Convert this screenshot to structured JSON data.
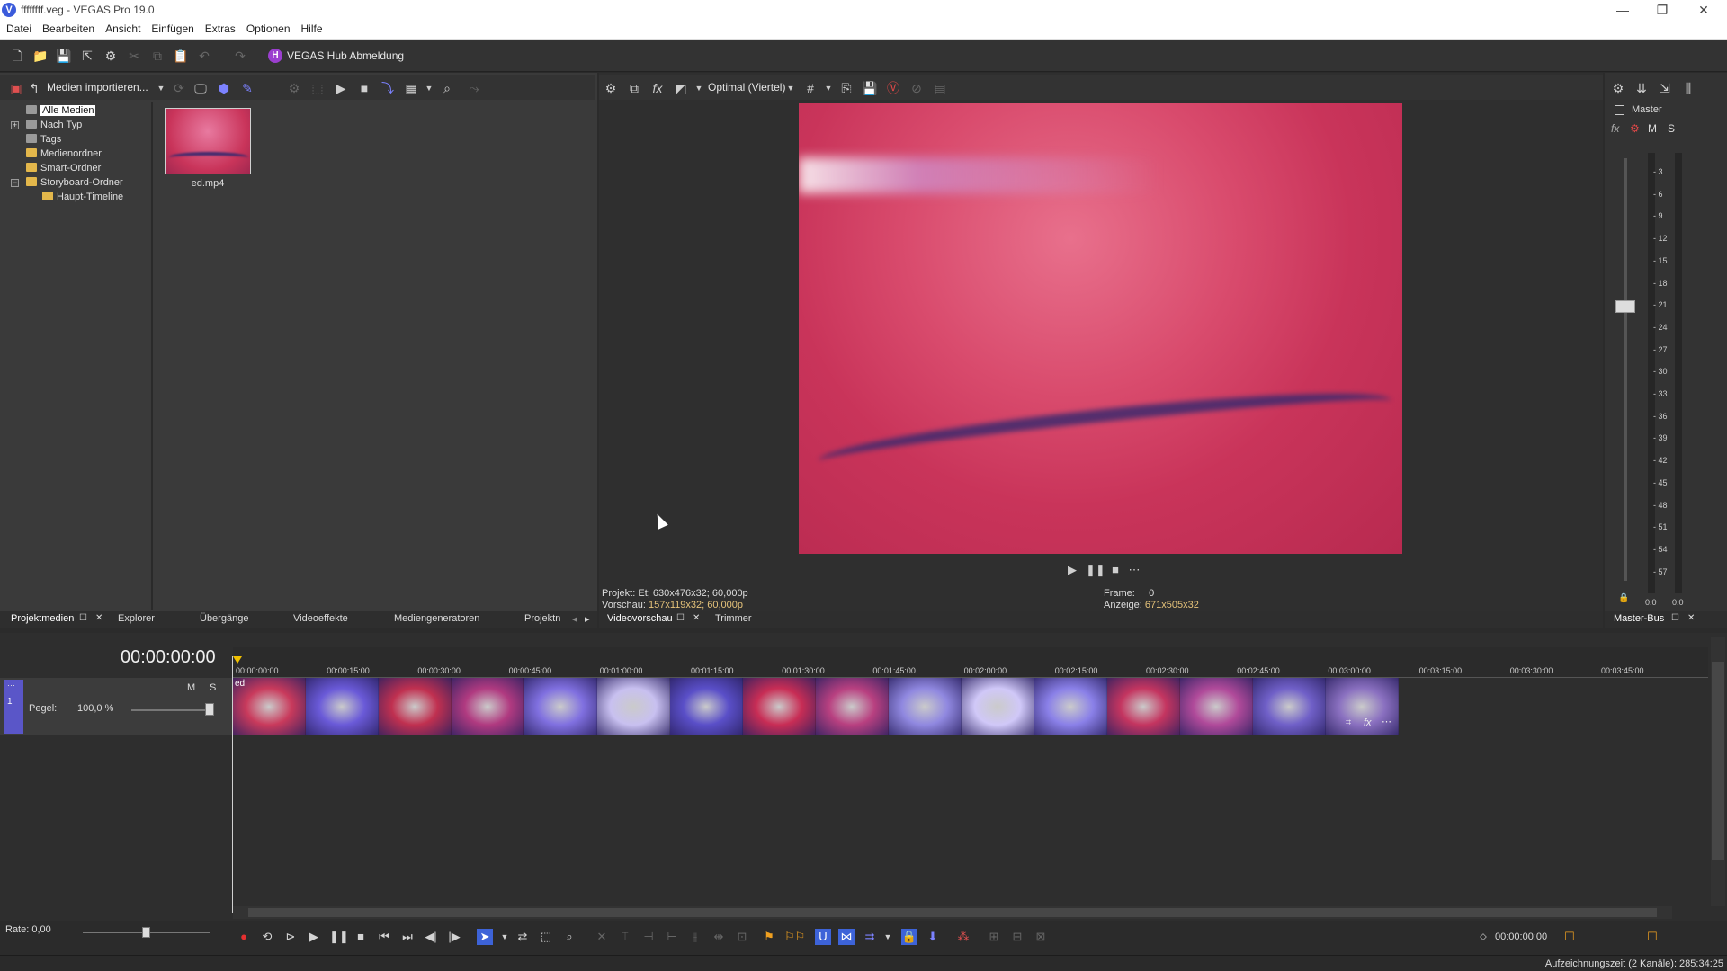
{
  "window": {
    "title": "ffffffff.veg - VEGAS Pro 19.0",
    "logo_letter": "V",
    "controls": [
      "—",
      "❐",
      "✕"
    ]
  },
  "menu": [
    "Datei",
    "Bearbeiten",
    "Ansicht",
    "Einfügen",
    "Extras",
    "Optionen",
    "Hilfe"
  ],
  "toolbar": {
    "hub_logo": "H",
    "hub_label": "VEGAS Hub Abmeldung"
  },
  "media": {
    "import_label": "Medien importieren...",
    "tree": [
      {
        "label": "Alle Medien",
        "icon": "folder-grey-icon",
        "selected": true
      },
      {
        "label": "Nach Typ",
        "icon": "folder-grey-icon",
        "expander": "+"
      },
      {
        "label": "Tags",
        "icon": "folder-grey-icon"
      },
      {
        "label": "Medienordner",
        "icon": "folder-icon"
      },
      {
        "label": "Smart-Ordner",
        "icon": "folder-icon"
      },
      {
        "label": "Storyboard-Ordner",
        "icon": "folder-icon",
        "expander": "−"
      },
      {
        "label": "Haupt-Timeline",
        "icon": "folder-icon"
      }
    ],
    "file_name": "ed.mp4"
  },
  "bottom_tabs_left": {
    "projektmedien": "Projektmedien",
    "explorer": "Explorer",
    "uebergaenge": "Übergänge",
    "videoeffekte": "Videoeffekte",
    "mediengeneratoren": "Mediengeneratoren",
    "projektn": "Projektn"
  },
  "preview": {
    "quality": "Optimal (Viertel)",
    "projekt_label": "Projekt:",
    "projekt_value": "630x476x32; 60,000p",
    "vorschau_label": "Vorschau:",
    "vorschau_value": "157x119x32; 60,000p",
    "frame_label": "Frame:",
    "frame_value": "0",
    "anzeige_label": "Anzeige:",
    "anzeige_value": "671x505x32",
    "tab_videovorschau": "Videovorschau",
    "tab_trimmer": "Trimmer"
  },
  "master": {
    "label": "Master",
    "fx": "fx",
    "m": "M",
    "s": "S",
    "scale": [
      "3",
      "6",
      "9",
      "12",
      "15",
      "18",
      "21",
      "24",
      "27",
      "30",
      "33",
      "36",
      "39",
      "42",
      "45",
      "48",
      "51",
      "54",
      "57"
    ],
    "left_value": "0.0",
    "right_value": "0.0",
    "tab_label": "Master-Bus"
  },
  "timeline": {
    "timecode": "00:00:00:00",
    "ruler": [
      "00:00:00:00",
      "00:00:15:00",
      "00:00:30:00",
      "00:00:45:00",
      "00:01:00:00",
      "00:01:15:00",
      "00:01:30:00",
      "00:01:45:00",
      "00:02:00:00",
      "00:02:15:00",
      "00:02:30:00",
      "00:02:45:00",
      "00:03:00:00",
      "00:03:15:00",
      "00:03:30:00",
      "00:03:45:00"
    ],
    "track_number": "1",
    "track_m": "M",
    "track_s": "S",
    "pegel_label": "Pegel:",
    "pegel_value": "100,0 %",
    "clip_label": "ed",
    "thumb_colors": [
      "#c93a5c",
      "#6a5ad8",
      "#c03050",
      "#b03a80",
      "#8070e0",
      "#c8c0f0",
      "#5a4fc8",
      "#c82d55",
      "#b84080",
      "#9088e0",
      "#d0c8f8",
      "#8a80e8",
      "#c43560",
      "#b04a9a",
      "#7060c8",
      "#8a70c0"
    ],
    "rate_label": "Rate: 0,00",
    "cursor_time": "00:00:00:00"
  },
  "status": {
    "record_time": "Aufzeichnungszeit (2 Kanäle): 285:34:25"
  }
}
